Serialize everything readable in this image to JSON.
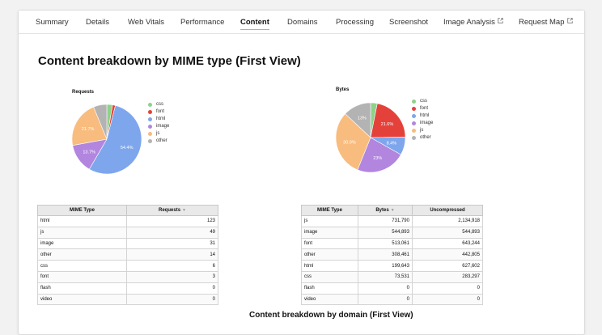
{
  "tabs": [
    {
      "label": "Summary",
      "active": false,
      "external": false
    },
    {
      "label": "Details",
      "active": false,
      "external": false
    },
    {
      "label": "Web Vitals",
      "active": false,
      "external": false
    },
    {
      "label": "Performance",
      "active": false,
      "external": false
    },
    {
      "label": "Content",
      "active": true,
      "external": false
    },
    {
      "label": "Domains",
      "active": false,
      "external": false
    },
    {
      "label": "Processing",
      "active": false,
      "external": false
    },
    {
      "label": "Screenshot",
      "active": false,
      "external": false
    },
    {
      "label": "Image Analysis",
      "active": false,
      "external": true
    },
    {
      "label": "Request Map",
      "active": false,
      "external": true
    }
  ],
  "heading": "Content breakdown by MIME type (First View)",
  "legend": [
    {
      "label": "css",
      "color": "#8ed28a"
    },
    {
      "label": "font",
      "color": "#e5413b"
    },
    {
      "label": "html",
      "color": "#7ea6ec"
    },
    {
      "label": "image",
      "color": "#b285df"
    },
    {
      "label": "js",
      "color": "#f8bc7e"
    },
    {
      "label": "other",
      "color": "#b3b3b3"
    }
  ],
  "chart_data": [
    {
      "type": "pie",
      "title": "Requests",
      "slices": [
        {
          "label": "css",
          "value": 6,
          "pct_label": ""
        },
        {
          "label": "font",
          "value": 3,
          "pct_label": ""
        },
        {
          "label": "html",
          "value": 123,
          "pct_label": "54.4%"
        },
        {
          "label": "image",
          "value": 31,
          "pct_label": "13.7%"
        },
        {
          "label": "js",
          "value": 49,
          "pct_label": "21.7%"
        },
        {
          "label": "other",
          "value": 14,
          "pct_label": ""
        }
      ]
    },
    {
      "type": "pie",
      "title": "Bytes",
      "slices": [
        {
          "label": "css",
          "value": 73531,
          "pct_label": ""
        },
        {
          "label": "font",
          "value": 513061,
          "pct_label": "21.6%"
        },
        {
          "label": "html",
          "value": 199643,
          "pct_label": "8.4%"
        },
        {
          "label": "image",
          "value": 544893,
          "pct_label": "23%"
        },
        {
          "label": "js",
          "value": 731790,
          "pct_label": "30.9%"
        },
        {
          "label": "other",
          "value": 308461,
          "pct_label": "13%"
        }
      ]
    }
  ],
  "requests_table": {
    "headers": [
      "MIME Type",
      "Requests"
    ],
    "rows": [
      [
        "html",
        "123"
      ],
      [
        "js",
        "49"
      ],
      [
        "image",
        "31"
      ],
      [
        "other",
        "14"
      ],
      [
        "css",
        "6"
      ],
      [
        "font",
        "3"
      ],
      [
        "flash",
        "0"
      ],
      [
        "video",
        "0"
      ]
    ]
  },
  "bytes_table": {
    "headers": [
      "MIME Type",
      "Bytes",
      "Uncompressed"
    ],
    "rows": [
      [
        "js",
        "731,790",
        "2,134,918"
      ],
      [
        "image",
        "544,893",
        "544,893"
      ],
      [
        "font",
        "513,061",
        "643,244"
      ],
      [
        "other",
        "308,461",
        "442,805"
      ],
      [
        "html",
        "199,643",
        "627,602"
      ],
      [
        "css",
        "73,531",
        "283,297"
      ],
      [
        "flash",
        "0",
        "0"
      ],
      [
        "video",
        "0",
        "0"
      ]
    ]
  },
  "bottom_partial_heading": "Content breakdown by domain (First View)"
}
